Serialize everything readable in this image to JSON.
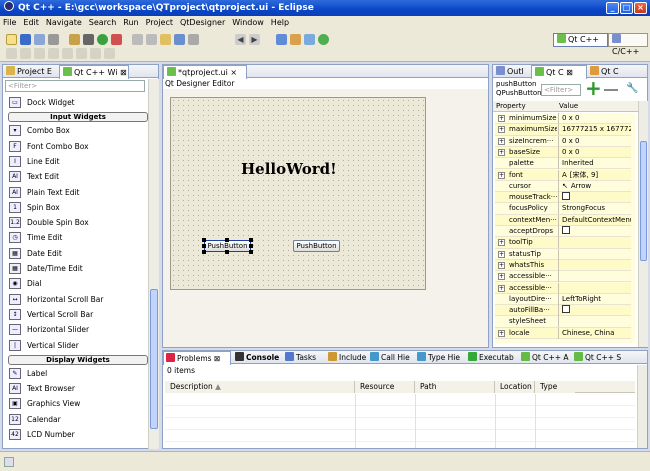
{
  "window": {
    "title": "Qt C++ - E:\\gcc\\workspace\\QTproject\\qtproject.ui - Eclipse"
  },
  "menu": [
    "File",
    "Edit",
    "Navigate",
    "Search",
    "Run",
    "Project",
    "QtDesigner",
    "Window",
    "Help"
  ],
  "perspectives": [
    "Qt C++",
    "C/C++"
  ],
  "left_panel": {
    "tabs": [
      "Project E",
      "Qt C++ Wi"
    ],
    "filter_placeholder": "<Filter>",
    "items": [
      {
        "type": "item",
        "label": "Dock Widget",
        "icon": "dock-widget-icon"
      },
      {
        "type": "cat",
        "label": "Input Widgets"
      },
      {
        "type": "item",
        "label": "Combo Box",
        "icon": "combo-box-icon"
      },
      {
        "type": "item",
        "label": "Font Combo Box",
        "icon": "font-combo-box-icon"
      },
      {
        "type": "item",
        "label": "Line Edit",
        "icon": "line-edit-icon"
      },
      {
        "type": "item",
        "label": "Text Edit",
        "icon": "text-edit-icon"
      },
      {
        "type": "item",
        "label": "Plain Text Edit",
        "icon": "plain-text-edit-icon"
      },
      {
        "type": "item",
        "label": "Spin Box",
        "icon": "spin-box-icon"
      },
      {
        "type": "item",
        "label": "Double Spin Box",
        "icon": "double-spin-box-icon"
      },
      {
        "type": "item",
        "label": "Time Edit",
        "icon": "time-edit-icon"
      },
      {
        "type": "item",
        "label": "Date Edit",
        "icon": "date-edit-icon"
      },
      {
        "type": "item",
        "label": "Date/Time Edit",
        "icon": "date-time-edit-icon"
      },
      {
        "type": "item",
        "label": "Dial",
        "icon": "dial-icon"
      },
      {
        "type": "item",
        "label": "Horizontal Scroll Bar",
        "icon": "horizontal-scroll-bar-icon"
      },
      {
        "type": "item",
        "label": "Vertical Scroll Bar",
        "icon": "vertical-scroll-bar-icon"
      },
      {
        "type": "item",
        "label": "Horizontal Slider",
        "icon": "horizontal-slider-icon"
      },
      {
        "type": "item",
        "label": "Vertical Slider",
        "icon": "vertical-slider-icon"
      },
      {
        "type": "cat",
        "label": "Display Widgets"
      },
      {
        "type": "item",
        "label": "Label",
        "icon": "label-icon"
      },
      {
        "type": "item",
        "label": "Text Browser",
        "icon": "text-browser-icon"
      },
      {
        "type": "item",
        "label": "Graphics View",
        "icon": "graphics-view-icon"
      },
      {
        "type": "item",
        "label": "Calendar",
        "icon": "calendar-icon"
      },
      {
        "type": "item",
        "label": "LCD Number",
        "icon": "lcd-number-icon"
      }
    ]
  },
  "editor": {
    "tab": "*qtproject.ui",
    "subtitle": "Qt Designer Editor",
    "form_label": "HelloWord!",
    "buttons": [
      "PushButton",
      "PushButton"
    ]
  },
  "right_panel": {
    "tabs": [
      "Outl",
      "Qt C",
      "Qt C"
    ],
    "object_name": "pushButton",
    "object_class": "QPushButton",
    "filter_placeholder": "<Filter>",
    "headers": [
      "Property",
      "Value"
    ],
    "properties": [
      {
        "name": "minimumSize",
        "value": "0 x 0",
        "exp": true
      },
      {
        "name": "maximumSize",
        "value": "16777215 x 16777215",
        "exp": true
      },
      {
        "name": "sizeIncrem···",
        "value": "0 x 0",
        "exp": true
      },
      {
        "name": "baseSize",
        "value": "0 x 0",
        "exp": true
      },
      {
        "name": "palette",
        "value": "Inherited",
        "exp": false
      },
      {
        "name": "font",
        "value": "[宋体, 9]",
        "exp": true,
        "prefix": "A"
      },
      {
        "name": "cursor",
        "value": "Arrow",
        "exp": false,
        "prefix": "↖"
      },
      {
        "name": "mouseTrack···",
        "value": "",
        "exp": false,
        "check": true
      },
      {
        "name": "focusPolicy",
        "value": "StrongFocus",
        "exp": false
      },
      {
        "name": "contextMen···",
        "value": "DefaultContextMenu",
        "exp": false
      },
      {
        "name": "acceptDrops",
        "value": "",
        "exp": false,
        "check": true
      },
      {
        "name": "toolTip",
        "value": "",
        "exp": true
      },
      {
        "name": "statusTip",
        "value": "",
        "exp": true
      },
      {
        "name": "whatsThis",
        "value": "",
        "exp": true
      },
      {
        "name": "accessible···",
        "value": "",
        "exp": true
      },
      {
        "name": "accessible···",
        "value": "",
        "exp": true
      },
      {
        "name": "layoutDire···",
        "value": "LeftToRight",
        "exp": false
      },
      {
        "name": "autoFillBa···",
        "value": "",
        "exp": false,
        "check": true
      },
      {
        "name": "styleSheet",
        "value": "",
        "exp": false
      },
      {
        "name": "locale",
        "value": "Chinese, China",
        "exp": true
      }
    ]
  },
  "bottom_panel": {
    "tabs": [
      "Problems",
      "Console",
      "Tasks",
      "Include",
      "Call Hie",
      "Type Hie",
      "Executab",
      "Qt C++ A",
      "Qt C++ S"
    ],
    "count": "0 items",
    "columns": [
      "Description",
      "Resource",
      "Path",
      "Location",
      "Type"
    ]
  },
  "colors": {
    "accent": "#0a46c8",
    "panel_border": "#8fa2c6",
    "selection": "#316ac5"
  }
}
